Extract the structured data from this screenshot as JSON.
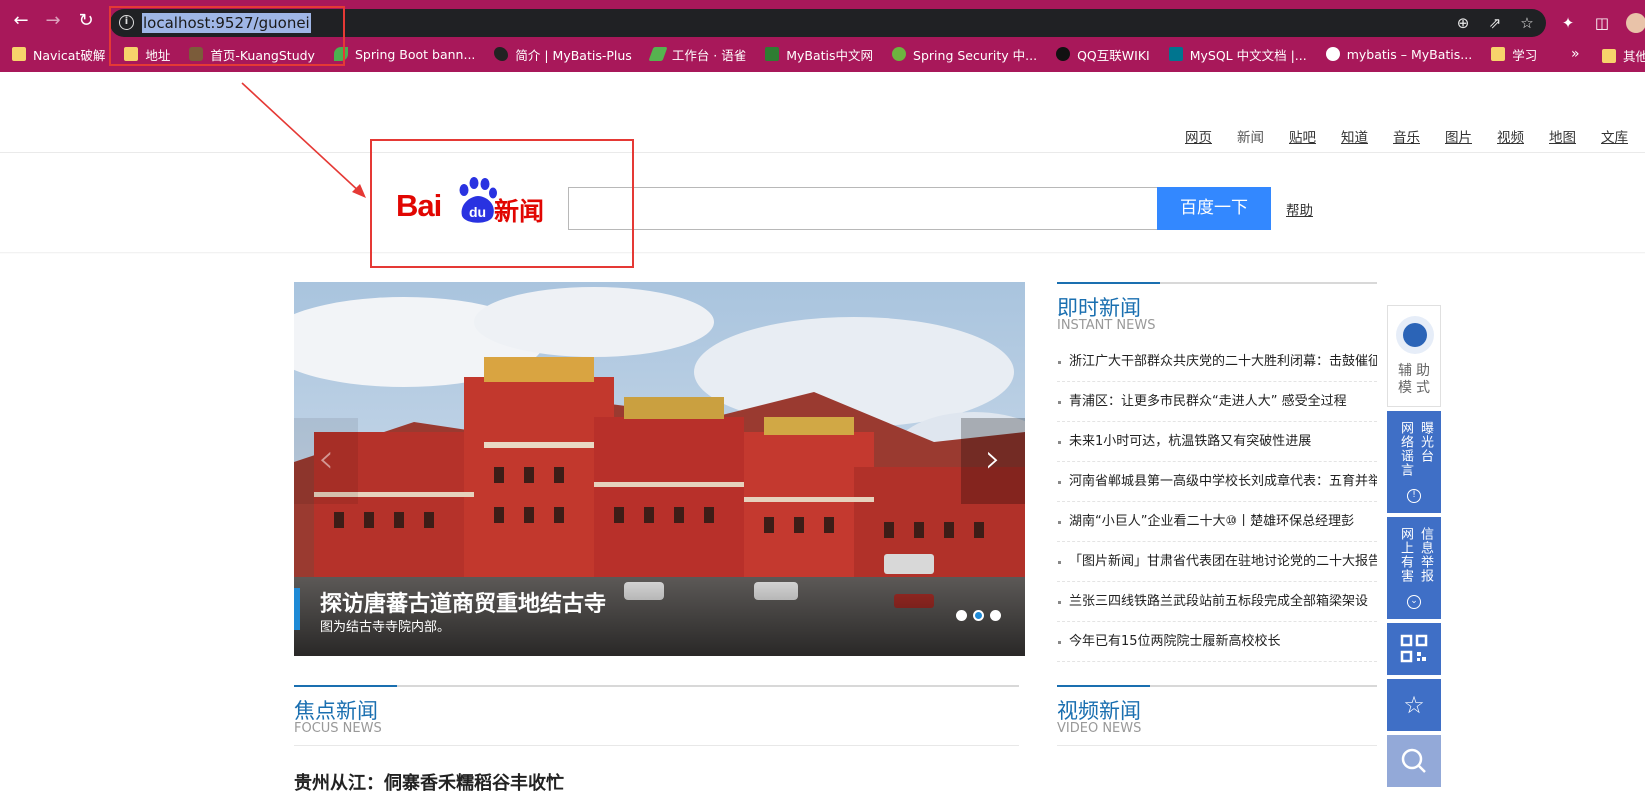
{
  "browser": {
    "url": "localhost:9527/guonei",
    "bookmarks": [
      {
        "label": "Navicat破解",
        "icon": "folder"
      },
      {
        "label": "地址",
        "icon": "folder"
      },
      {
        "label": "首页-KuangStudy",
        "icon": "site"
      },
      {
        "label": "Spring Boot bann...",
        "icon": "leaf"
      },
      {
        "label": "简介 | MyBatis-Plus",
        "icon": "bird"
      },
      {
        "label": "工作台 · 语雀",
        "icon": "pen"
      },
      {
        "label": "MyBatis中文网",
        "icon": "green"
      },
      {
        "label": "Spring Security 中...",
        "icon": "spring"
      },
      {
        "label": "QQ互联WIKI",
        "icon": "qq"
      },
      {
        "label": "MySQL 中文文档 |...",
        "icon": "mysql"
      },
      {
        "label": "mybatis – MyBatis...",
        "icon": "globe"
      },
      {
        "label": "学习",
        "icon": "folder"
      }
    ],
    "more_label": "»",
    "last_bookmark": "其他"
  },
  "topnav": [
    "网页",
    "新闻",
    "贴吧",
    "知道",
    "音乐",
    "图片",
    "视频",
    "地图",
    "文库"
  ],
  "logo": {
    "bai": "Bai",
    "du": "du",
    "news": "新闻"
  },
  "search": {
    "button": "百度一下",
    "help": "帮助",
    "value": ""
  },
  "carousel": {
    "title": "探访唐蕃古道商贸重地结古寺",
    "subtitle": "图为结古寺寺院内部。",
    "slides": 3,
    "active_slide": 2
  },
  "instant_news": {
    "title": "即时新闻",
    "subtitle": "INSTANT NEWS",
    "items": [
      "浙江广大干部群众共庆党的二十大胜利闭幕：击鼓催征",
      "青浦区：让更多市民群众“走进人大” 感受全过程",
      "未来1小时可达，杭温铁路又有突破性进展",
      "河南省郸城县第一高级中学校长刘成章代表：五育并举",
      "湖南“小巨人”企业看二十大⑩丨楚雄环保总经理彭",
      "「图片新闻」甘肃省代表团在驻地讨论党的二十大报告",
      "兰张三四线铁路兰武段站前五标段完成全部箱梁架设",
      "今年已有15位两院院士履新高校校长"
    ]
  },
  "focus_news": {
    "title": "焦点新闻",
    "subtitle": "FOCUS NEWS",
    "first_item": "贵州从江：侗寨香禾糯稻谷丰收忙"
  },
  "video_news": {
    "title": "视频新闻",
    "subtitle": "VIDEO NEWS"
  },
  "sidebar": {
    "assist": "辅助模式",
    "rumor_a": "网络谣言",
    "rumor_b": "曝光台",
    "report_a": "网上有害",
    "report_b": "信息举报"
  },
  "colors": {
    "chrome": "#a8185a",
    "accent_blue": "#1a6fb0",
    "search_button": "#3388ff",
    "annotation_red": "#e53935"
  }
}
